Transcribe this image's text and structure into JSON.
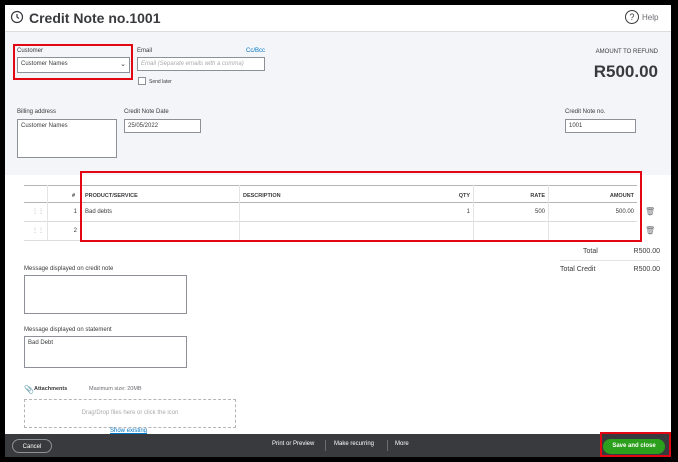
{
  "header": {
    "title": "Credit Note no.1001",
    "help": "Help"
  },
  "customer": {
    "label": "Customer",
    "value": "Customer Names"
  },
  "email": {
    "label": "Email",
    "placeholder": "Email (Separate emails with a comma)",
    "cc_bcc": "Cc/Bcc",
    "send_later": "Send later"
  },
  "refund": {
    "label": "AMOUNT TO REFUND",
    "value": "R500.00"
  },
  "billing": {
    "label": "Billing address",
    "value": "Customer Names"
  },
  "note_date": {
    "label": "Credit Note Date",
    "value": "25/05/2022"
  },
  "note_no": {
    "label": "Credit Note no.",
    "value": "1001"
  },
  "table": {
    "headers": {
      "num": "#",
      "product": "PRODUCT/SERVICE",
      "description": "DESCRIPTION",
      "qty": "QTY",
      "rate": "RATE",
      "amount": "AMOUNT"
    },
    "rows": [
      {
        "num": "1",
        "product": "Bad debts",
        "description": "",
        "qty": "1",
        "rate": "500",
        "amount": "500.00"
      },
      {
        "num": "2",
        "product": "",
        "description": "",
        "qty": "",
        "rate": "",
        "amount": ""
      }
    ]
  },
  "totals": {
    "total_label": "Total",
    "total_value": "R500.00",
    "credit_label": "Total Credit",
    "credit_value": "R500.00"
  },
  "messages": {
    "credit_label": "Message displayed on credit note",
    "credit_value": "",
    "statement_label": "Message displayed on statement",
    "statement_value": "Bad Debt"
  },
  "attachments": {
    "label": "Attachments",
    "max": "Maximum size: 20MB",
    "drop": "Drag/Drop files here or click the icon",
    "show_existing": "Show existing"
  },
  "footer": {
    "cancel": "Cancel",
    "print": "Print or Preview",
    "recurring": "Make recurring",
    "more": "More",
    "save": "Save and close"
  },
  "colors": {
    "highlight": "#e30613",
    "save": "#2ca01c",
    "footer": "#393a3d",
    "link": "#0077c5"
  }
}
